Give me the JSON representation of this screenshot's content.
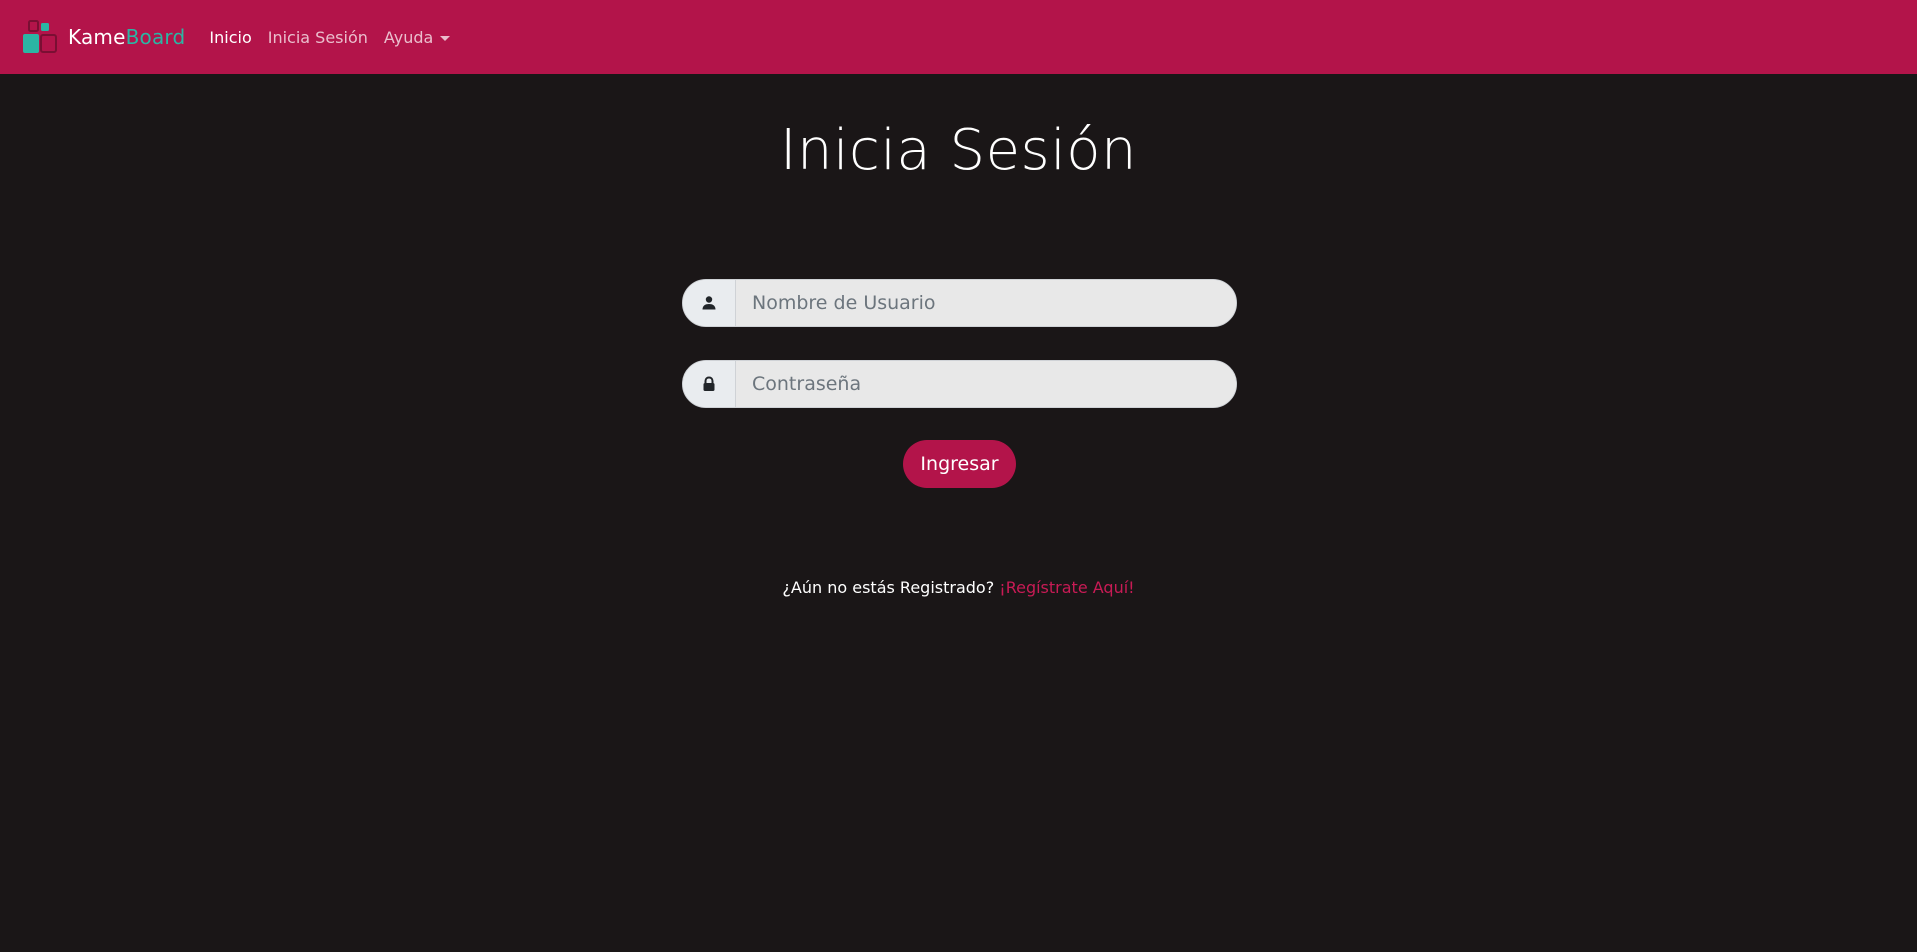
{
  "navbar": {
    "brand_primary": "Kame",
    "brand_accent": "Board",
    "links": [
      {
        "label": "Inicio"
      },
      {
        "label": "Inicia Sesión"
      },
      {
        "label": "Ayuda"
      }
    ],
    "bg_color": "#b3144a",
    "accent_color": "#2bb5a4"
  },
  "login": {
    "title": "Inicia Sesión",
    "username_placeholder": "Nombre de Usuario",
    "username_icon": "user-icon",
    "password_placeholder": "Contraseña",
    "password_icon": "lock-icon",
    "submit_label": "Ingresar"
  },
  "register": {
    "prompt": "¿Aún no estás Registrado?",
    "link_label": "¡Regístrate Aquí!"
  }
}
